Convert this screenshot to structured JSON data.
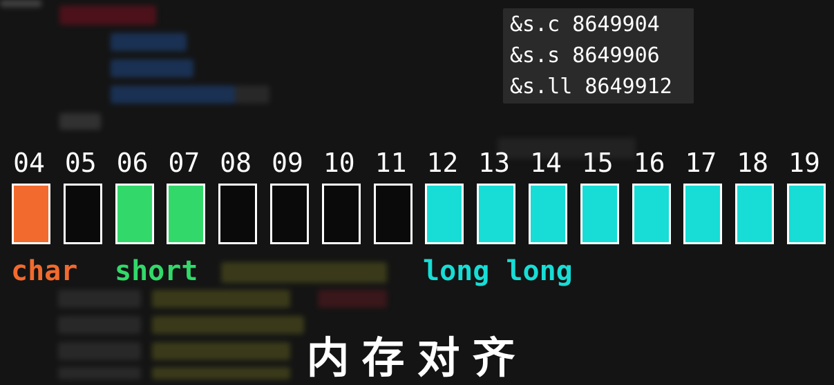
{
  "address_panel": {
    "lines": [
      "&s.c 8649904",
      "&s.s 8649906",
      "&s.ll 8649912"
    ]
  },
  "memory": {
    "cells": [
      {
        "label": "04",
        "color": "#f26a2e"
      },
      {
        "label": "05",
        "color": "#0a0a0a"
      },
      {
        "label": "06",
        "color": "#32d96a"
      },
      {
        "label": "07",
        "color": "#32d96a"
      },
      {
        "label": "08",
        "color": "#0a0a0a"
      },
      {
        "label": "09",
        "color": "#0a0a0a"
      },
      {
        "label": "10",
        "color": "#0a0a0a"
      },
      {
        "label": "11",
        "color": "#0a0a0a"
      },
      {
        "label": "12",
        "color": "#17ddd6"
      },
      {
        "label": "13",
        "color": "#17ddd6"
      },
      {
        "label": "14",
        "color": "#17ddd6"
      },
      {
        "label": "15",
        "color": "#17ddd6"
      },
      {
        "label": "16",
        "color": "#17ddd6"
      },
      {
        "label": "17",
        "color": "#17ddd6"
      },
      {
        "label": "18",
        "color": "#17ddd6"
      },
      {
        "label": "19",
        "color": "#17ddd6"
      }
    ]
  },
  "types": {
    "char": {
      "label": "char",
      "color": "#f26a2e"
    },
    "short": {
      "label": "short",
      "color": "#32d96a"
    },
    "long_long": {
      "label": "long long",
      "color": "#17ddd6"
    }
  },
  "caption": "内存对齐"
}
